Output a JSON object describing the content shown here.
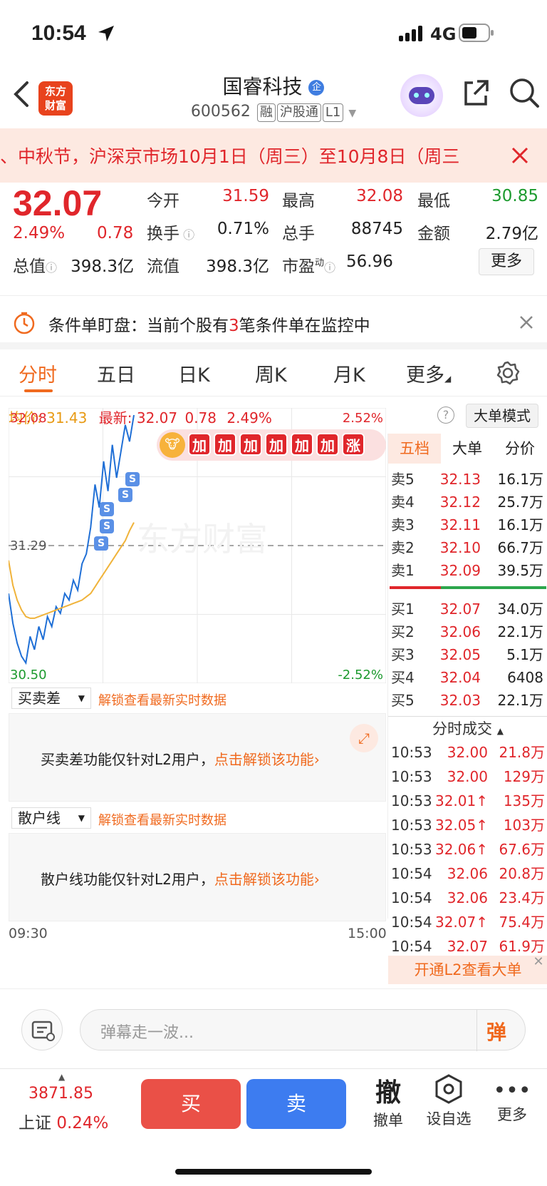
{
  "status": {
    "time": "10:54",
    "network": "4G"
  },
  "header": {
    "logo_line1": "东方",
    "logo_line2": "财富",
    "stock_name": "国睿科技",
    "badge": "企",
    "stock_code": "600562",
    "tags": [
      "融",
      "沪股通",
      "L1"
    ]
  },
  "notice": {
    "text": "、中秋节，沪深京市场10月1日（周三）至10月8日（周三"
  },
  "quote": {
    "price": "32.07",
    "change_pct": "2.49%",
    "change": "0.78",
    "open_label": "今开",
    "open": "31.59",
    "high_label": "最高",
    "high": "32.08",
    "low_label": "最低",
    "low": "30.85",
    "turnover_label": "换手",
    "turnover": "0.71%",
    "volume_label": "总手",
    "volume": "88745",
    "amount_label": "金额",
    "amount": "2.79亿",
    "mktcap_label": "总值",
    "mktcap": "398.3亿",
    "float_label": "流值",
    "float": "398.3亿",
    "pe_label": "市盈",
    "pe_sup": "动",
    "pe": "56.96",
    "more": "更多"
  },
  "condition": {
    "prefix": "条件单盯盘：当前个股有",
    "count": "3",
    "suffix": "笔条件单在监控中"
  },
  "tabs": [
    "分时",
    "五日",
    "日K",
    "周K",
    "月K",
    "更多"
  ],
  "chart_info": {
    "avg_label": "均价:",
    "avg": "31.43",
    "last_label": "最新:",
    "last": "32.07",
    "chg": "0.78",
    "pct": "2.49%",
    "mode_button": "大单模式"
  },
  "chart_data": {
    "type": "line",
    "ylim": [
      30.5,
      32.08
    ],
    "y_top_label": "32.08",
    "y_mid_label": "31.29",
    "y_bottom_label": "30.50",
    "pct_top_label": "2.52%",
    "pct_bottom_label": "-2.52%",
    "x_start": "09:30",
    "x_end": "15:00",
    "series": [
      {
        "values": [
          31.0,
          30.82,
          30.7,
          30.62,
          30.58,
          30.74,
          30.66,
          30.8,
          30.72,
          30.86,
          30.8,
          30.92,
          30.88,
          31.0,
          30.96,
          31.08,
          31.02,
          31.18,
          31.24,
          31.4,
          31.66,
          31.52,
          31.8,
          31.62,
          31.9,
          31.7,
          31.86,
          32.02,
          31.92,
          32.08
        ]
      },
      {
        "values": [
          31.2,
          31.05,
          30.96,
          30.9,
          30.86,
          30.85,
          30.85,
          30.86,
          30.87,
          30.88,
          30.89,
          30.9,
          30.91,
          30.92,
          30.93,
          30.94,
          30.95,
          30.96,
          30.98,
          31.0,
          31.04,
          31.08,
          31.12,
          31.16,
          31.2,
          31.24,
          31.28,
          31.32,
          31.38,
          31.43
        ]
      }
    ],
    "banner": [
      "加",
      "加",
      "加",
      "加",
      "加",
      "加",
      "涨"
    ],
    "watermark": "东方财富"
  },
  "orderbook": {
    "tabs": [
      "五档",
      "大单",
      "分价"
    ],
    "asks": [
      {
        "label": "卖5",
        "price": "32.13",
        "vol": "16.1万"
      },
      {
        "label": "卖4",
        "price": "32.12",
        "vol": "25.7万"
      },
      {
        "label": "卖3",
        "price": "32.11",
        "vol": "16.1万"
      },
      {
        "label": "卖2",
        "price": "32.10",
        "vol": "66.7万"
      },
      {
        "label": "卖1",
        "price": "32.09",
        "vol": "39.5万"
      }
    ],
    "bids": [
      {
        "label": "买1",
        "price": "32.07",
        "vol": "34.0万"
      },
      {
        "label": "买2",
        "price": "32.06",
        "vol": "22.1万"
      },
      {
        "label": "买3",
        "price": "32.05",
        "vol": "5.1万"
      },
      {
        "label": "买4",
        "price": "32.04",
        "vol": "6408"
      },
      {
        "label": "买5",
        "price": "32.03",
        "vol": "22.1万"
      }
    ],
    "trades_title": "分时成交",
    "trades": [
      {
        "t": "10:53",
        "p": "32.00",
        "v": "21.8万"
      },
      {
        "t": "10:53",
        "p": "32.00",
        "v": "129万"
      },
      {
        "t": "10:53",
        "p": "32.01↑",
        "v": "135万"
      },
      {
        "t": "10:53",
        "p": "32.05↑",
        "v": "103万"
      },
      {
        "t": "10:53",
        "p": "32.06↑",
        "v": "67.6万"
      },
      {
        "t": "10:54",
        "p": "32.06",
        "v": "20.8万"
      },
      {
        "t": "10:54",
        "p": "32.06",
        "v": "23.4万"
      },
      {
        "t": "10:54",
        "p": "32.07↑",
        "v": "75.4万"
      },
      {
        "t": "10:54",
        "p": "32.07",
        "v": "61.9万"
      }
    ],
    "l2_cta": "开通L2查看大单"
  },
  "indicators": [
    {
      "select": "买卖差",
      "unlock": "解锁查看最新实时数据",
      "msg": "买卖差功能仅针对L2用户，",
      "link": "点击解锁该功能"
    },
    {
      "select": "散户线",
      "unlock": "解锁查看最新实时数据",
      "msg": "散户线功能仅针对L2用户，",
      "link": "点击解锁该功能"
    }
  ],
  "danmu": {
    "placeholder": "弹幕走一波...",
    "btn": "弹"
  },
  "bottom": {
    "index_value": "3871.85",
    "index_name": "上证",
    "index_pct": "0.24%",
    "buy": "买",
    "sell": "卖",
    "cancel_icon": "撤",
    "cancel": "撤单",
    "watch": "设自选",
    "more": "更多"
  },
  "colors": {
    "red": "#e0262b",
    "green": "#1c9a2e",
    "orange": "#f06a1f",
    "blue": "#1f6fd6",
    "avg_line": "#f0b33a"
  }
}
